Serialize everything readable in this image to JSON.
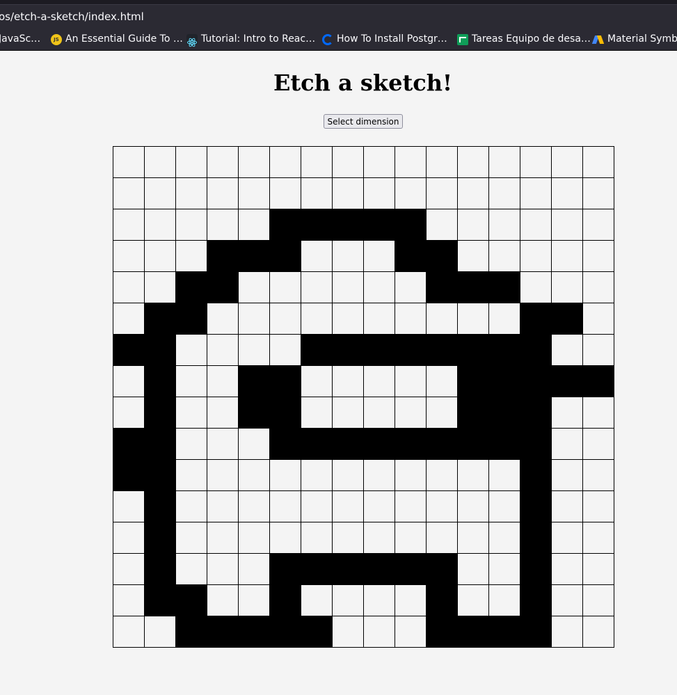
{
  "browser": {
    "url": "os/etch-a-sketch/index.html",
    "bookmarks": [
      {
        "label": "JavaSc…",
        "icon": "none"
      },
      {
        "label": "An Essential Guide To …",
        "icon": "js-icon"
      },
      {
        "label": "Tutorial: Intro to Reac…",
        "icon": "react-icon"
      },
      {
        "label": "How To Install Postgr…",
        "icon": "digitalocean-icon"
      },
      {
        "label": "Tareas Equipo de desa…",
        "icon": "sheets-icon"
      },
      {
        "label": "Material Symbo",
        "icon": "material-icon"
      }
    ]
  },
  "page": {
    "title": "Etch a sketch!",
    "dimension_button": "Select dimension"
  },
  "grid": {
    "size": 16,
    "filled_color": "#000000",
    "empty_color": "#f4f4f4",
    "rows": [
      "0000000000000000",
      "0000000000000000",
      "0000011111000000",
      "0001110001100000",
      "0011000000111000",
      "0110000000000110",
      "1100001111111100",
      "0100110000011111",
      "0100110000011100",
      "1100011111111100",
      "1100000000000100",
      "0100000000000100",
      "0100000000000100",
      "0100011111100100",
      "0110010000100100",
      "0011111000111100"
    ]
  }
}
